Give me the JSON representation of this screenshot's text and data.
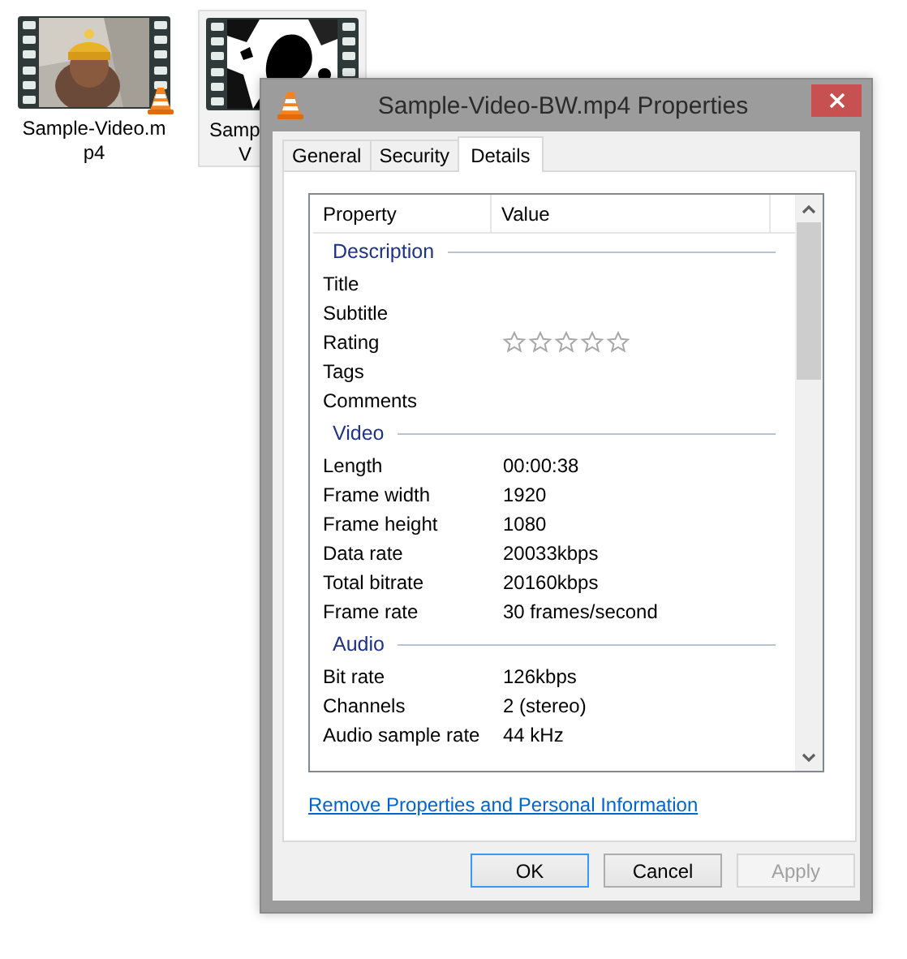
{
  "desktop_icons": [
    {
      "label_lines": [
        "Sample-Video.m",
        "p4"
      ],
      "selected": false,
      "kind": "color"
    },
    {
      "label_lines": [
        "Samp",
        "V"
      ],
      "selected": true,
      "kind": "bw"
    }
  ],
  "dialog": {
    "title": "Sample-Video-BW.mp4 Properties",
    "tabs": [
      {
        "label": "General",
        "selected": false
      },
      {
        "label": "Security",
        "selected": false
      },
      {
        "label": "Details",
        "selected": true
      }
    ],
    "details": {
      "columns": [
        "Property",
        "Value"
      ],
      "sections": [
        {
          "heading": "Description",
          "rows": [
            {
              "kind": "text",
              "property": "Title"
            },
            {
              "kind": "text",
              "property": "Subtitle"
            },
            {
              "kind": "rating",
              "property": "Rating",
              "stars": 0
            },
            {
              "kind": "text",
              "property": "Tags"
            },
            {
              "kind": "text",
              "property": "Comments"
            }
          ]
        },
        {
          "heading": "Video",
          "rows": [
            {
              "kind": "text",
              "property": "Length",
              "value": "00:00:38"
            },
            {
              "kind": "text",
              "property": "Frame width",
              "value": "1920"
            },
            {
              "kind": "text",
              "property": "Frame height",
              "value": "1080"
            },
            {
              "kind": "text",
              "property": "Data rate",
              "value": "20033kbps"
            },
            {
              "kind": "text",
              "property": "Total bitrate",
              "value": "20160kbps"
            },
            {
              "kind": "text",
              "property": "Frame rate",
              "value": "30 frames/second"
            }
          ]
        },
        {
          "heading": "Audio",
          "rows": [
            {
              "kind": "text",
              "property": "Bit rate",
              "value": "126kbps"
            },
            {
              "kind": "text",
              "property": "Channels",
              "value": "2 (stereo)"
            },
            {
              "kind": "text",
              "property": "Audio sample rate",
              "value": "44 kHz"
            }
          ]
        }
      ]
    },
    "link": "Remove Properties and Personal Information",
    "buttons": [
      {
        "label": "OK",
        "default": true,
        "disabled": false
      },
      {
        "label": "Cancel",
        "default": false,
        "disabled": false
      },
      {
        "label": "Apply",
        "default": false,
        "disabled": true
      }
    ]
  }
}
